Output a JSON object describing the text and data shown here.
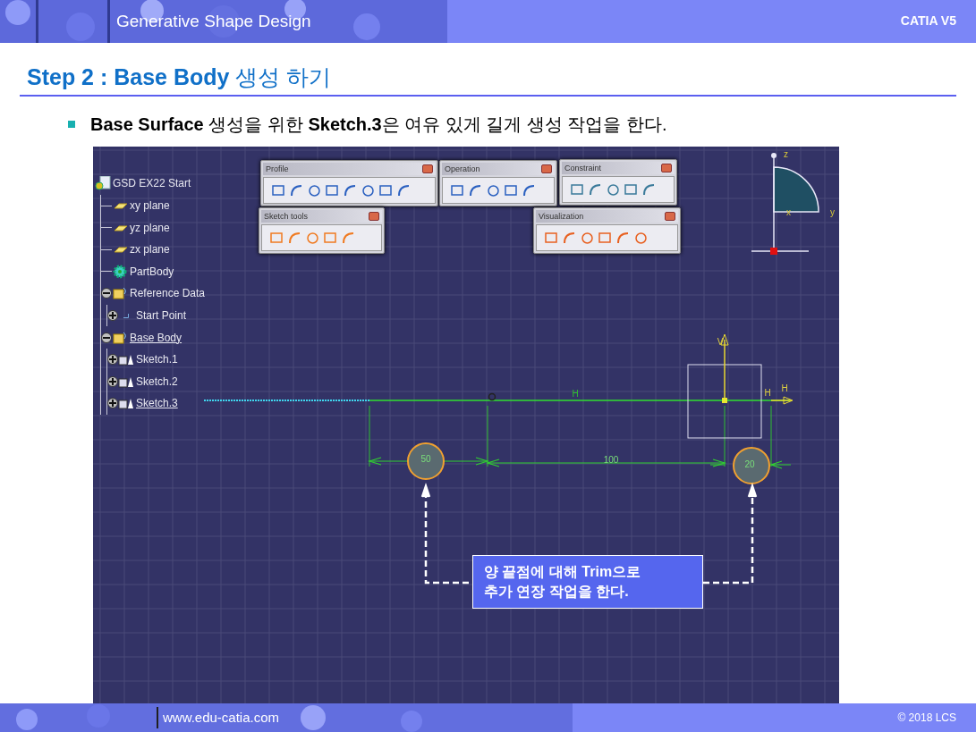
{
  "header": {
    "title": "Generative Shape Design",
    "product": "CATIA V5"
  },
  "step_title": "**Step 2 : Base Body** 생성 하기",
  "bullet": "**Base Surface** 생성을 위한 **Sketch.3**은 여유 있게 길게 생성 작업을 한다.",
  "catia": {
    "tree": [
      {
        "label": "GSD EX22 Start",
        "kind": "document",
        "underlined": false,
        "children": [
          {
            "label": "xy plane",
            "kind": "plane",
            "underlined": false
          },
          {
            "label": "yz plane",
            "kind": "plane",
            "underlined": false
          },
          {
            "label": "zx plane",
            "kind": "plane",
            "underlined": false
          },
          {
            "label": "PartBody",
            "kind": "body",
            "underlined": false
          },
          {
            "label": "Reference Data",
            "kind": "set",
            "underlined": false,
            "expanded": true,
            "children": [
              {
                "label": "Start Point",
                "kind": "point",
                "underlined": false,
                "expanded": false
              }
            ]
          },
          {
            "label": "Base Body",
            "kind": "set",
            "underlined": true,
            "expanded": true,
            "children": [
              {
                "label": "Sketch.1",
                "kind": "sketch",
                "underlined": false,
                "expanded": false
              },
              {
                "label": "Sketch.2",
                "kind": "sketch",
                "underlined": false,
                "expanded": false
              },
              {
                "label": "Sketch.3",
                "kind": "sketch",
                "underlined": true,
                "expanded": false
              }
            ]
          }
        ]
      }
    ],
    "toolbars": [
      {
        "title": "Profile"
      },
      {
        "title": "Operation"
      },
      {
        "title": "Constraint"
      },
      {
        "title": "Sketch tools"
      },
      {
        "title": "Visualization"
      }
    ],
    "sketch_labels": [
      {
        "kind": "dimension",
        "text": "50"
      },
      {
        "kind": "dimension",
        "text": "100"
      },
      {
        "kind": "dimension",
        "text": "20"
      },
      {
        "kind": "constraint",
        "text": "H"
      },
      {
        "kind": "axis",
        "text": "H"
      },
      {
        "kind": "axis",
        "text": "H"
      },
      {
        "kind": "axis",
        "text": "V"
      }
    ],
    "compass_labels": [
      "z",
      "x",
      "y"
    ],
    "callout": [
      "양 끝점에 대해 **Trim**으로",
      "추가 연장 작업을 한다."
    ]
  },
  "footer": {
    "url": "www.edu-catia.com",
    "copyright": "© 2018 LCS"
  }
}
